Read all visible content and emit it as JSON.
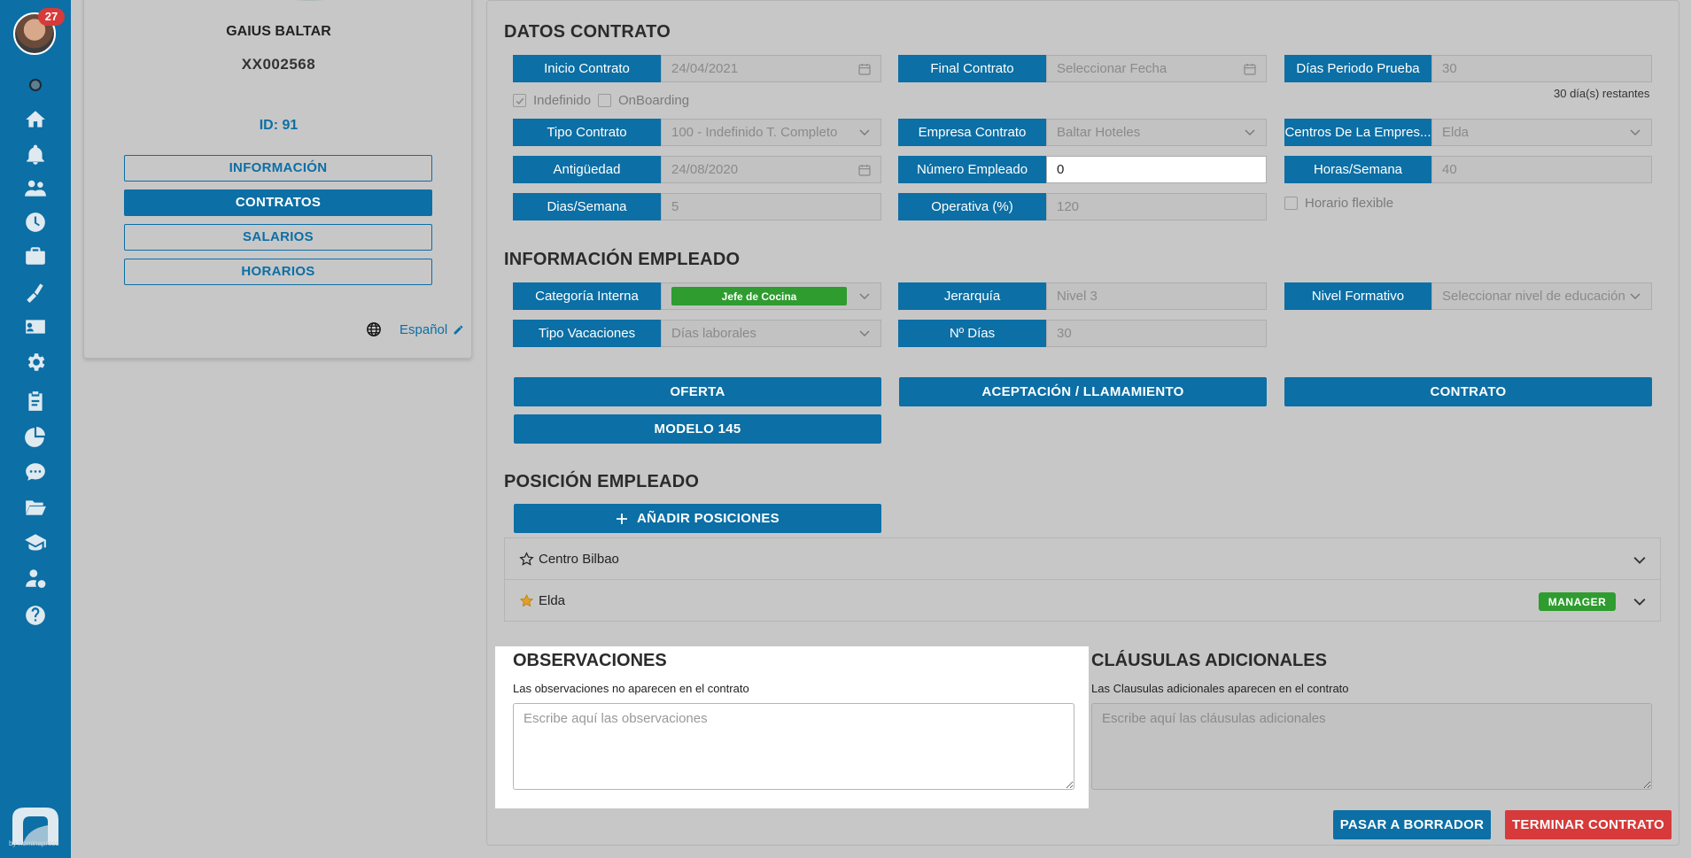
{
  "sidebar": {
    "notifications": "27",
    "icons": [
      "status-dot-icon",
      "home-icon",
      "bell-icon",
      "users-icon",
      "clock-icon",
      "briefcase-icon",
      "paint-roller-icon",
      "id-card-icon",
      "gear-icon",
      "clipboard-icon",
      "pie-chart-icon",
      "chat-icon",
      "folder-icon",
      "graduation-cap-icon",
      "user-money-icon",
      "help-icon"
    ],
    "logo_text": "by nominapress"
  },
  "profile": {
    "name": "GAIUS BALTAR",
    "code": "XX002568",
    "id": "ID: 91",
    "buttons": [
      "INFORMACIÓN",
      "CONTRATOS",
      "SALARIOS",
      "HORARIOS"
    ],
    "active_button": "CONTRATOS",
    "language": "Español"
  },
  "datos_contrato": {
    "title": "DATOS CONTRATO",
    "inicio_label": "Inicio Contrato",
    "inicio_value": "24/04/2021",
    "final_label": "Final Contrato",
    "final_placeholder": "Seleccionar Fecha",
    "prueba_label": "Días Periodo Prueba",
    "prueba_value": "30",
    "restantes": "30 día(s) restantes",
    "indefinido": "Indefinido",
    "onboarding": "OnBoarding",
    "tipo_label": "Tipo Contrato",
    "tipo_value": "100 - Indefinido T. Completo",
    "empresa_label": "Empresa Contrato",
    "empresa_value": "Baltar Hoteles",
    "centros_label": "Centros De La Empres...",
    "centros_value": "Elda",
    "antiguedad_label": "Antigüedad",
    "antiguedad_value": "24/08/2020",
    "numero_label": "Número Empleado",
    "numero_value": "0",
    "horas_label": "Horas/Semana",
    "horas_value": "40",
    "dias_label": "Dias/Semana",
    "dias_value": "5",
    "operativa_label": "Operativa (%)",
    "operativa_value": "120",
    "horario_flexible": "Horario flexible"
  },
  "info_empleado": {
    "title": "INFORMACIÓN EMPLEADO",
    "categoria_label": "Categoría Interna",
    "categoria_value": "Jefe de Cocina",
    "jerarquia_label": "Jerarquía",
    "jerarquia_value": "Nivel 3",
    "nivel_label": "Nivel Formativo",
    "nivel_placeholder": "Seleccionar nivel de educación",
    "vacaciones_label": "Tipo Vacaciones",
    "vacaciones_value": "Días laborales",
    "ndias_label": "Nº Días",
    "ndias_value": "30"
  },
  "docs": {
    "oferta": "OFERTA",
    "aceptacion": "ACEPTACIÓN / LLAMAMIENTO",
    "contrato": "CONTRATO",
    "modelo": "MODELO 145"
  },
  "posicion": {
    "title": "POSICIÓN EMPLEADO",
    "add": "AÑADIR POSICIONES",
    "rows": [
      {
        "name": "Centro Bilbao",
        "badge": ""
      },
      {
        "name": "Elda",
        "badge": "MANAGER"
      }
    ]
  },
  "observaciones": {
    "title": "OBSERVACIONES",
    "note": "Las observaciones no aparecen en el contrato",
    "placeholder": "Escribe aquí las observaciones"
  },
  "clausulas": {
    "title": "CLÁUSULAS ADICIONALES",
    "note": "Las Clausulas adicionales aparecen en el contrato",
    "placeholder": "Escribe aquí las cláusulas adicionales"
  },
  "footer": {
    "borrador": "PASAR A BORRADOR",
    "terminar": "TERMINAR CONTRATO"
  },
  "colors": {
    "primary": "#0c6fa5",
    "green": "#2e9c2e",
    "danger": "#d63a3a"
  }
}
